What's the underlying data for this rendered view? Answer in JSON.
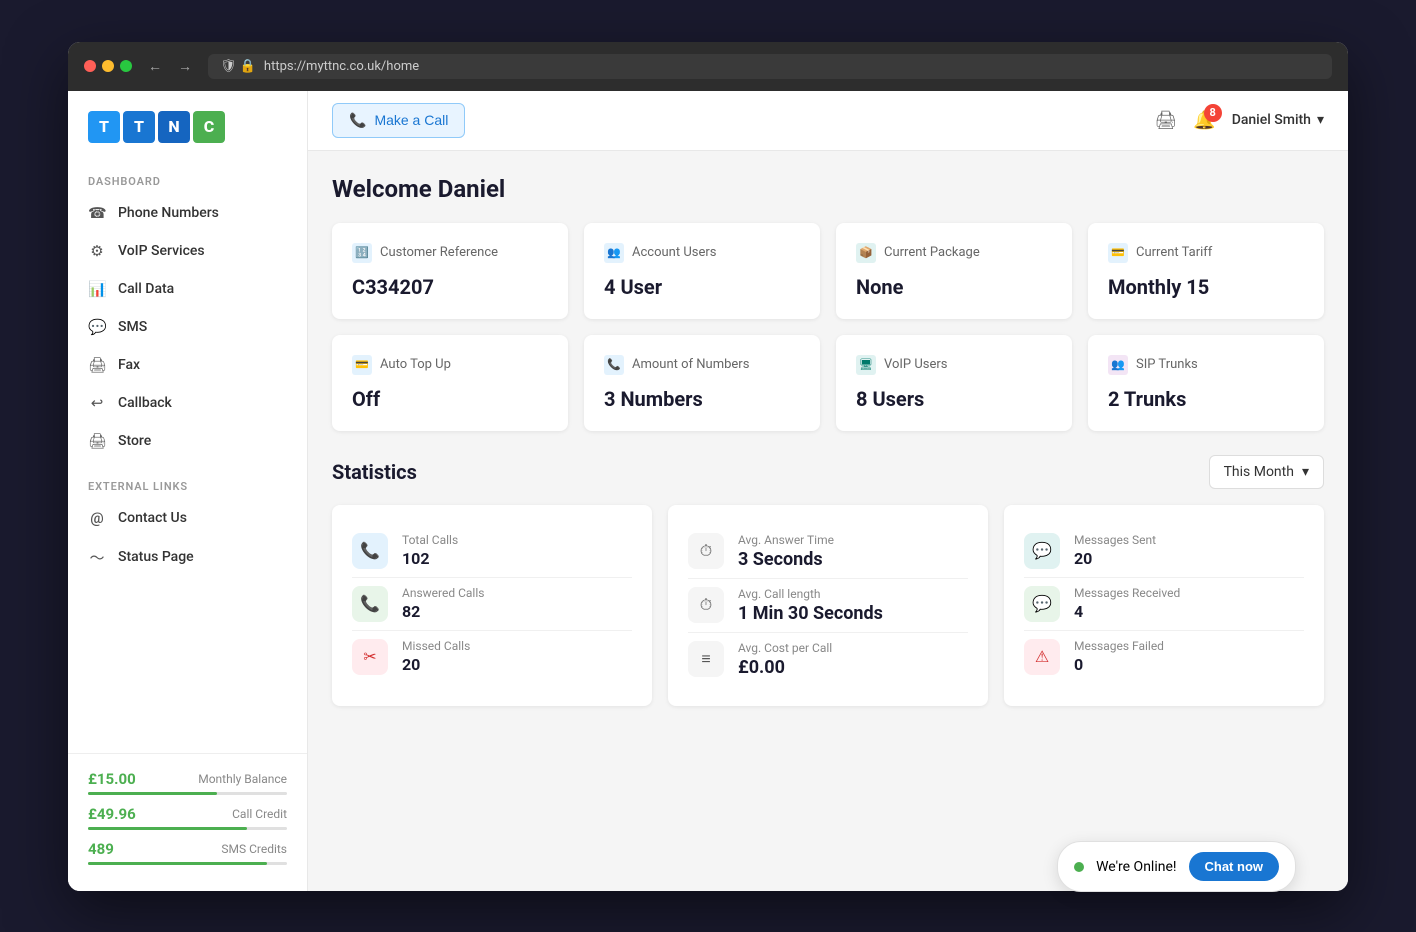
{
  "browser": {
    "url": "https://myttnc.co.uk/home"
  },
  "logo": {
    "tiles": [
      "T",
      "T",
      "N",
      "C"
    ]
  },
  "sidebar": {
    "dashboard_label": "DASHBOARD",
    "items": [
      {
        "label": "Phone Numbers",
        "icon": "📞",
        "id": "phone-numbers"
      },
      {
        "label": "VoIP Services",
        "icon": "👤",
        "id": "voip-services"
      },
      {
        "label": "Call Data",
        "icon": "📊",
        "id": "call-data"
      },
      {
        "label": "SMS",
        "icon": "💬",
        "id": "sms"
      },
      {
        "label": "Fax",
        "icon": "🖨",
        "id": "fax"
      },
      {
        "label": "Callback",
        "icon": "🔁",
        "id": "callback"
      },
      {
        "label": "Store",
        "icon": "🖨",
        "id": "store"
      }
    ],
    "external_links_label": "EXTERNAL LINKS",
    "external_items": [
      {
        "label": "Contact Us",
        "icon": "@",
        "id": "contact-us"
      },
      {
        "label": "Status Page",
        "icon": "〜",
        "id": "status-page"
      }
    ],
    "balance": {
      "monthly": "£15.00",
      "monthly_label": "Monthly Balance",
      "monthly_fill": "65",
      "credit": "£49.96",
      "credit_label": "Call Credit",
      "credit_fill": "80",
      "sms": "489",
      "sms_label": "SMS Credits",
      "sms_fill": "90"
    }
  },
  "topbar": {
    "make_call_label": "Make a Call",
    "notifications_count": "8",
    "user_name": "Daniel Smith"
  },
  "welcome": {
    "title": "Welcome Daniel"
  },
  "info_cards": [
    {
      "icon_label": "customer-reference-icon",
      "header": "Customer Reference",
      "value": "C334207",
      "icon_char": "🔢"
    },
    {
      "icon_label": "account-users-icon",
      "header": "Account Users",
      "value": "4 User",
      "icon_char": "👥"
    },
    {
      "icon_label": "current-package-icon",
      "header": "Current Package",
      "value": "None",
      "icon_char": "📦"
    },
    {
      "icon_label": "current-tariff-icon",
      "header": "Current Tariff",
      "value": "Monthly 15",
      "icon_char": "💳"
    },
    {
      "icon_label": "auto-topup-icon",
      "header": "Auto Top Up",
      "value": "Off",
      "icon_char": "💳"
    },
    {
      "icon_label": "amount-numbers-icon",
      "header": "Amount of Numbers",
      "value": "3 Numbers",
      "icon_char": "📞"
    },
    {
      "icon_label": "voip-users-icon",
      "header": "VoIP Users",
      "value": "8 Users",
      "icon_char": "🖥"
    },
    {
      "icon_label": "sip-trunks-icon",
      "header": "SIP Trunks",
      "value": "2 Trunks",
      "icon_char": "👥"
    }
  ],
  "statistics": {
    "title": "Statistics",
    "filter_label": "This Month",
    "columns": [
      {
        "rows": [
          {
            "label": "Total Calls",
            "value": "102",
            "icon_type": "blue",
            "icon_char": "📞"
          },
          {
            "label": "Answered Calls",
            "value": "82",
            "icon_type": "green",
            "icon_char": "📞"
          },
          {
            "label": "Missed Calls",
            "value": "20",
            "icon_type": "red",
            "icon_char": "✂"
          }
        ]
      },
      {
        "rows": [
          {
            "label": "Avg. Answer Time",
            "value": "3 Seconds",
            "icon_type": "gray",
            "icon_char": "⏱"
          },
          {
            "label": "Avg. Call length",
            "value": "1 Min 30 Seconds",
            "icon_type": "gray",
            "icon_char": "⏱"
          },
          {
            "label": "Avg. Cost per Call",
            "value": "£0.00",
            "icon_type": "gray",
            "icon_char": "≡"
          }
        ]
      },
      {
        "rows": [
          {
            "label": "Messages Sent",
            "value": "20",
            "icon_type": "teal",
            "icon_char": "💬"
          },
          {
            "label": "Messages Received",
            "value": "4",
            "icon_type": "green",
            "icon_char": "💬"
          },
          {
            "label": "Messages Failed",
            "value": "0",
            "icon_type": "red",
            "icon_char": "⚠"
          }
        ]
      }
    ]
  },
  "chat": {
    "online_text": "We're Online!",
    "button_label": "Chat now"
  }
}
